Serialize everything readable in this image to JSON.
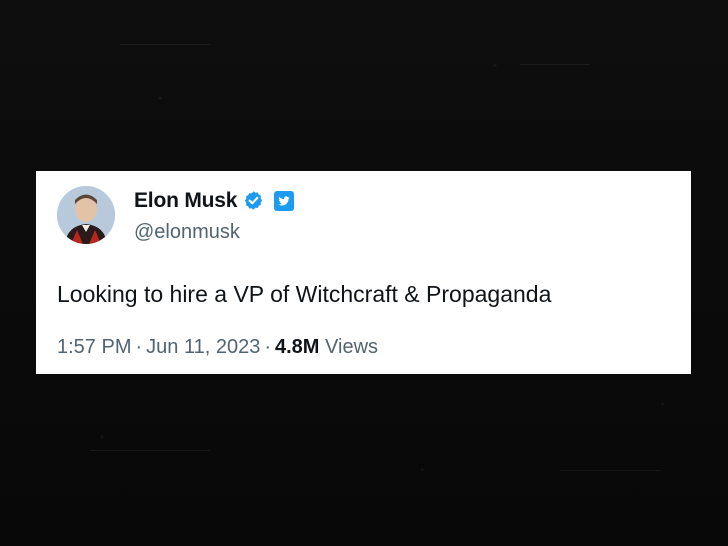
{
  "tweet": {
    "display_name": "Elon Musk",
    "handle": "@elonmusk",
    "text": "Looking to hire a VP of Witchcraft & Propaganda",
    "time": "1:57 PM",
    "separator": "·",
    "date": "Jun 11, 2023",
    "views_count": "4.8M",
    "views_label": "Views"
  },
  "icons": {
    "verified": "verified-badge-icon",
    "platform": "twitter-bird-icon",
    "avatar": "profile-avatar"
  },
  "colors": {
    "background": "#0b0b0b",
    "card": "#ffffff",
    "text_primary": "#0f1419",
    "text_secondary": "#536471",
    "twitter_blue": "#1d9bf0"
  }
}
